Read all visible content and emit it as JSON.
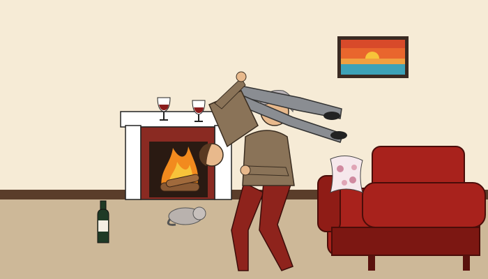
{
  "scene": {
    "colors": {
      "wall": "#f6ebd6",
      "floor": "#cdb898",
      "baseboard": "#5a3d2a",
      "sofa": "#a8221c",
      "sofa_dark": "#7c1712",
      "fireplace_brick": "#8a2a22",
      "mantel": "#ffffff",
      "sweater": "#8a7358",
      "pants_red": "#8e231c",
      "pants_gray": "#8a8d92",
      "wine": "#8a1c1c",
      "bottle_glass": "#1f3a26",
      "hair_gray": "#b8b2b6",
      "skin": "#e8b98c"
    },
    "icons": {
      "painting": "sunset-painting-icon",
      "glass": "wine-glass-icon",
      "bottle": "wine-bottle-icon",
      "cat": "sleeping-cat-icon",
      "pillow": "floral-pillow-icon",
      "fire": "fire-icon"
    }
  }
}
